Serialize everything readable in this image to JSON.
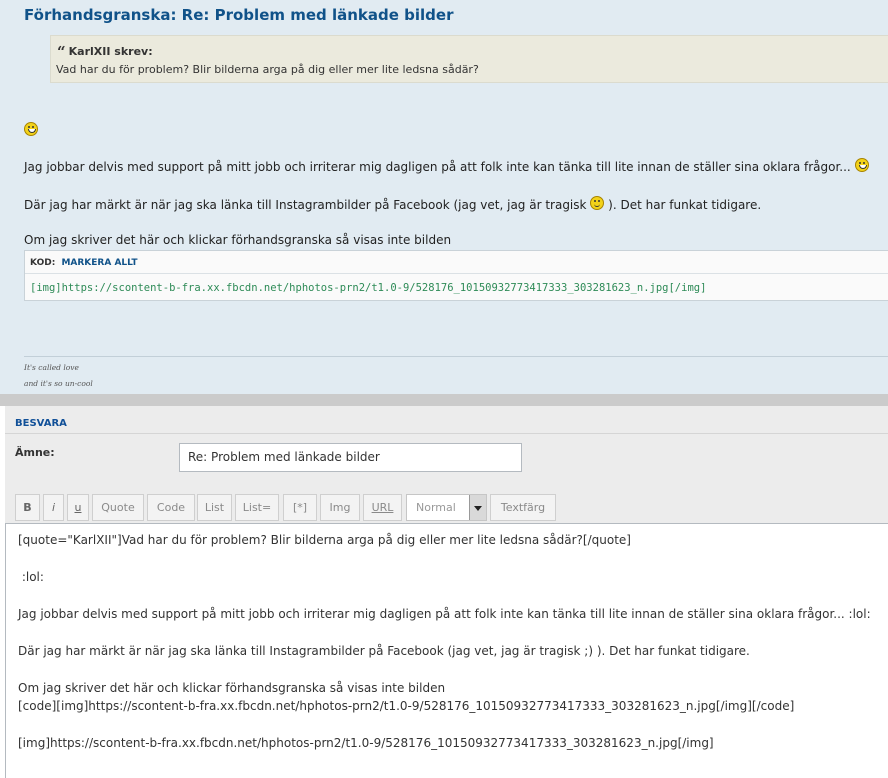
{
  "preview": {
    "title": "Förhandsgranska: Re: Problem med länkade bilder",
    "quote": {
      "author": "KarlXII skrev:",
      "text": "Vad har du för problem? Blir bilderna arga på dig eller mer lite ledsna sådär?"
    },
    "paragraph1": "Jag jobbar delvis med support på mitt jobb och irriterar mig dagligen på att folk inte kan tänka till lite innan de ställer sina oklara frågor...",
    "paragraph2_before": "Där jag har märkt är när jag ska länka till Instagrambilder på Facebook (jag vet, jag är tragisk",
    "paragraph2_after": "). Det har funkat tidigare.",
    "paragraph3": "Om jag skriver det här och klickar förhandsgranska så visas inte bilden",
    "code": {
      "label": "KOD:",
      "select_all": "MARKERA ALLT",
      "content": "[img]https://scontent-b-fra.xx.fbcdn.net/hphotos-prn2/t1.0-9/528176_10150932773417333_303281623_n.jpg[/img]"
    },
    "signature": [
      "It's called love",
      "and it's so un-cool"
    ]
  },
  "reply": {
    "heading": "BESVARA",
    "subject_label": "Ämne:",
    "subject_value": "Re: Problem med länkade bilder",
    "toolbar": {
      "bold": "B",
      "italic": "i",
      "underline": "u",
      "quote": "Quote",
      "code": "Code",
      "list": "List",
      "list_ordered": "List=",
      "list_item": "[*]",
      "img": "Img",
      "url": "URL",
      "font_size": "Normal",
      "text_color": "Textfärg"
    },
    "message_lines": [
      "[quote=\"KarlXII\"]Vad har du för problem? Blir bilderna arga på dig eller mer lite ledsna sådär?[/quote]",
      " :lol:",
      "Jag jobbar delvis med support på mitt jobb och irriterar mig dagligen på att folk inte kan tänka till lite innan de ställer sina oklara frågor... :lol:",
      "Där jag har märkt är när jag ska länka till Instagrambilder på Facebook (jag vet, jag är tragisk ;) ). Det har funkat tidigare.",
      "Om jag skriver det här och klickar förhandsgranska så visas inte bilden",
      "[code][img]https://scontent-b-fra.xx.fbcdn.net/hphotos-prn2/t1.0-9/528176_10150932773417333_303281623_n.jpg[/img][/code]",
      "[img]https://scontent-b-fra.xx.fbcdn.net/hphotos-prn2/t1.0-9/528176_10150932773417333_303281623_n.jpg[/img]"
    ]
  },
  "icons": {
    "laugh": "laughing-smiley-icon",
    "wink": "wink-smiley-icon",
    "dropdown": "chevron-down-icon"
  }
}
